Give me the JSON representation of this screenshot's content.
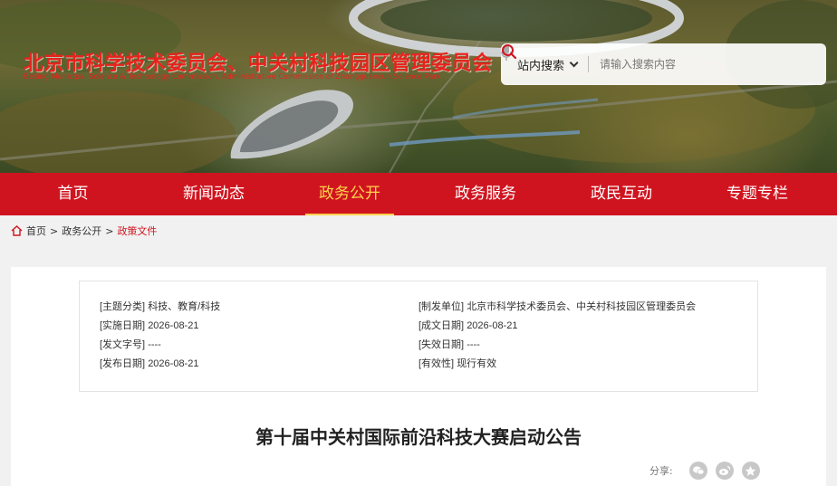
{
  "header": {
    "title": "北京市科学技术委员会、中关村科技园区管理委员会",
    "subtitle": "Beijing Municipal Science & Technology Commission, Administrative Commission of Zhongguancun Science Park"
  },
  "search": {
    "scope_label": "站内搜索",
    "placeholder": "请输入搜索内容"
  },
  "nav": {
    "items": [
      {
        "label": "首页"
      },
      {
        "label": "新闻动态"
      },
      {
        "label": "政务公开",
        "active": true
      },
      {
        "label": "政务服务"
      },
      {
        "label": "政民互动"
      },
      {
        "label": "专题专栏"
      }
    ]
  },
  "breadcrumb": {
    "items": [
      "首页",
      "政务公开",
      "政策文件"
    ],
    "separator": ">"
  },
  "meta": {
    "left": [
      {
        "key": "[主题分类]",
        "value": "科技、教育/科技"
      },
      {
        "key": "[实施日期]",
        "value": "2026-08-21"
      },
      {
        "key": "[发文字号]",
        "value": "----"
      },
      {
        "key": "[发布日期]",
        "value": "2026-08-21"
      }
    ],
    "right": [
      {
        "key": "[制发单位]",
        "value": "北京市科学技术委员会、中关村科技园区管理委员会"
      },
      {
        "key": "[成文日期]",
        "value": "2026-08-21"
      },
      {
        "key": "[失效日期]",
        "value": "----"
      },
      {
        "key": "[有效性]",
        "value": "现行有效"
      }
    ]
  },
  "article": {
    "title": "第十届中关村国际前沿科技大赛启动公告"
  },
  "share": {
    "label": "分享:",
    "icons": [
      "wechat-icon",
      "weibo-icon",
      "favorite-icon"
    ]
  },
  "colors": {
    "primary_red": "#d0141f",
    "active_nav": "#ffd24d",
    "title_red": "#e8231c"
  }
}
